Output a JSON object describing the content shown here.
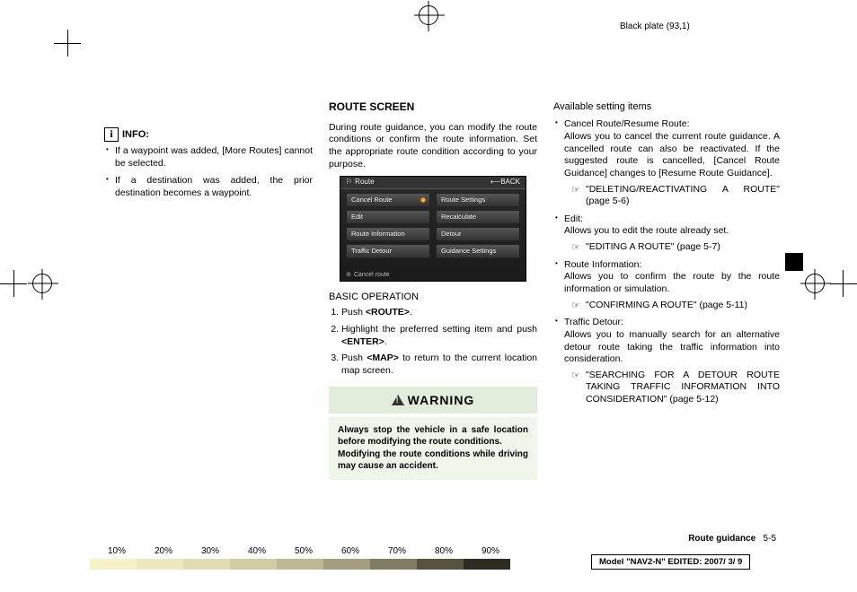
{
  "plate_label": "Black plate (93,1)",
  "info": {
    "heading": "INFO:",
    "items": [
      "If a waypoint was added, [More Routes] cannot be selected.",
      "If a destination was added, the prior destination becomes a waypoint."
    ]
  },
  "section_title": "ROUTE SCREEN",
  "intro": "During route guidance, you can modify the route conditions or confirm the route information. Set the appropriate route condition according to your purpose.",
  "screenshot": {
    "title": "Route",
    "back": "BACK",
    "left": [
      "Cancel Route",
      "Edit",
      "Route Information",
      "Traffic Detour"
    ],
    "right": [
      "Route Settings",
      "Recalculate",
      "Detour",
      "Guidance Settings"
    ],
    "footer": "Cancel route"
  },
  "basic_op": {
    "heading": "BASIC OPERATION",
    "steps": [
      {
        "pre": "Push ",
        "kw": "<ROUTE>",
        "post": "."
      },
      {
        "pre": "Highlight the preferred setting item and push ",
        "kw": "<ENTER>",
        "post": "."
      },
      {
        "pre": "Push ",
        "kw": "<MAP>",
        "post": " to return to the current location map screen."
      }
    ]
  },
  "warning": {
    "title": "WARNING",
    "body1": "Always stop the vehicle in a safe location before modifying the route conditions.",
    "body2": "Modifying the route conditions while driving may cause an accident."
  },
  "available": {
    "heading": "Available setting items",
    "items": [
      {
        "title": "Cancel Route/Resume Route:",
        "body": "Allows you to cancel the current route guidance. A cancelled route can also be reactivated. If the suggested route is cancelled, [Cancel Route Guidance] changes to [Resume Route Guidance].",
        "ref": "\"DELETING/REACTIVATING A ROUTE\" (page 5-6)"
      },
      {
        "title": "Edit:",
        "body": "Allows you to edit the route already set.",
        "ref": "\"EDITING A ROUTE\" (page 5-7)"
      },
      {
        "title": "Route Information:",
        "body": "Allows you to confirm the route by the route information or simulation.",
        "ref": "\"CONFIRMING A ROUTE\" (page 5-11)"
      },
      {
        "title": "Traffic Detour:",
        "body": "Allows you to manually search for an alternative detour route taking the traffic information into consideration.",
        "ref": "\"SEARCHING FOR A DETOUR ROUTE TAKING TRAFFIC INFORMATION INTO CONSIDERATION\" (page 5-12)"
      }
    ]
  },
  "footer": {
    "label": "Route guidance",
    "page": "5-5"
  },
  "model_line": "Model \"NAV2-N\" EDITED: 2007/ 3/ 9",
  "percents": [
    "10%",
    "20%",
    "30%",
    "40%",
    "50%",
    "60%",
    "70%",
    "80%",
    "90%"
  ],
  "swatch_colors": [
    "#f5f1c8",
    "#ece8bf",
    "#e0dcb3",
    "#d0cca4",
    "#bcb893",
    "#a29e7f",
    "#807c63",
    "#565341",
    "#2e2c22"
  ]
}
